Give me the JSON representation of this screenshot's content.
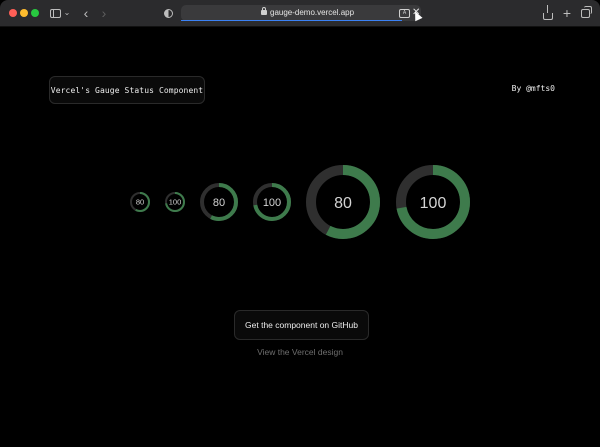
{
  "browser": {
    "url": "gauge-demo.vercel.app",
    "load_progress": 0.92,
    "translate_label": "A",
    "stop_symbol": "✕",
    "back_symbol": "‹",
    "forward_symbol": "›",
    "new_tab_symbol": "+",
    "sidebar_chevron_symbol": "⌄"
  },
  "page": {
    "title": "Vercel's Gauge Status Component",
    "author": "By @mfts0",
    "github_button": "Get the component on GitHub",
    "design_link": "View the Vercel design"
  },
  "gauges": [
    {
      "value": 80,
      "label": "80",
      "size": "tiny"
    },
    {
      "value": 100,
      "label": "100",
      "size": "tiny"
    },
    {
      "value": 80,
      "label": "80",
      "size": "small"
    },
    {
      "value": 100,
      "label": "100",
      "size": "small"
    },
    {
      "value": 80,
      "label": "80",
      "size": "large"
    },
    {
      "value": 100,
      "label": "100",
      "size": "large"
    }
  ],
  "colors": {
    "background": "#000000",
    "gauge_fill": "#3e7b4c",
    "gauge_track": "#2f2f2f",
    "text_primary": "#ededed",
    "text_muted": "#6e6e6e"
  },
  "icons": {
    "sidebar": "sidebar-icon",
    "privacy": "privacy-report-icon",
    "lock": "lock-icon",
    "translate": "translate-icon",
    "share": "share-icon",
    "tabs": "tab-overview-icon"
  }
}
